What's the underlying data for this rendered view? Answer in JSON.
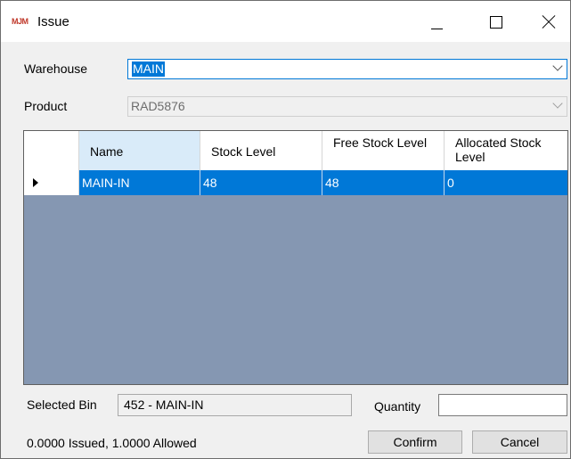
{
  "window": {
    "logo": "MJM",
    "title": "Issue"
  },
  "form": {
    "warehouse_label": "Warehouse",
    "warehouse_value": "MAIN",
    "product_label": "Product",
    "product_value": "RAD5876"
  },
  "grid": {
    "columns": [
      "Name",
      "Stock Level",
      "Free Stock Level",
      "Allocated Stock Level"
    ],
    "rows": [
      {
        "name": "MAIN-IN",
        "stock_level": "48",
        "free_stock_level": "48",
        "allocated_stock_level": "0"
      }
    ]
  },
  "footer": {
    "selected_bin_label": "Selected Bin",
    "selected_bin_value": "452 - MAIN-IN",
    "quantity_label": "Quantity",
    "quantity_value": "",
    "status_text": "0.0000 Issued, 1.0000 Allowed",
    "confirm_label": "Confirm",
    "cancel_label": "Cancel"
  },
  "colors": {
    "selection": "#0078d7",
    "grid_background": "#8597b2"
  }
}
